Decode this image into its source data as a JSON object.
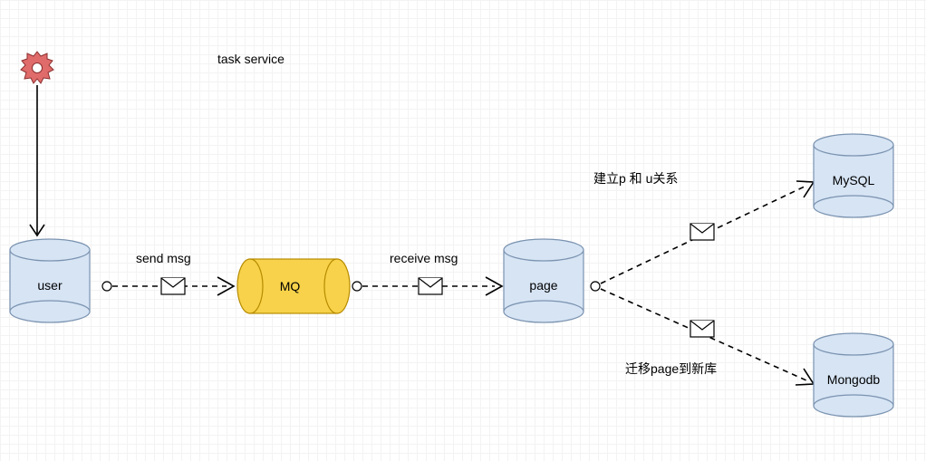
{
  "title": "task service",
  "nodes": {
    "gear": {
      "name": "gear-icon"
    },
    "user": {
      "label": "user"
    },
    "mq": {
      "label": "MQ"
    },
    "page": {
      "label": "page"
    },
    "mysql": {
      "label": "MySQL"
    },
    "mongodb": {
      "label": "Mongodb"
    }
  },
  "edges": {
    "gear_to_user": {},
    "user_to_mq": {
      "label": "send msg"
    },
    "mq_to_page": {
      "label": "receive msg"
    },
    "page_to_mysql": {
      "label": "建立p 和 u关系"
    },
    "page_to_mongodb": {
      "label": "迁移page到新库"
    }
  }
}
